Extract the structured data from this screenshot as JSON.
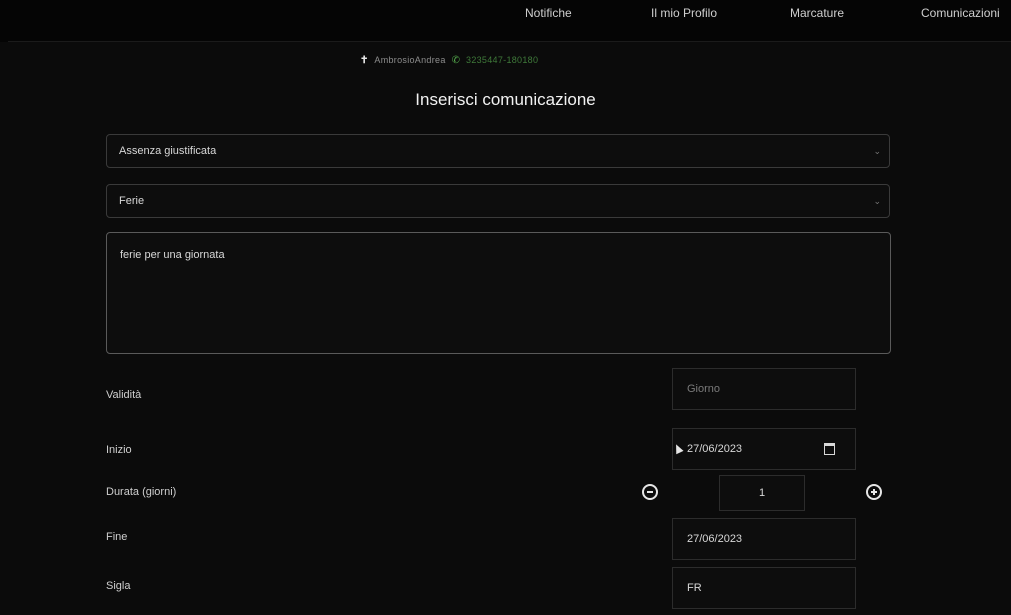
{
  "nav": {
    "items": [
      "Notifiche",
      "Il mio Profilo",
      "Marcature",
      "Comunicazioni"
    ]
  },
  "user": {
    "name": "AmbrosioAndrea",
    "phone": "3235447-180180"
  },
  "page": {
    "title": "Inserisci comunicazione"
  },
  "form": {
    "tipo": {
      "value": "Assenza giustificata"
    },
    "causale": {
      "value": "Ferie"
    },
    "note": {
      "value": "ferie per una giornata"
    },
    "validita": {
      "label": "Validità",
      "placeholder": "Giorno"
    },
    "inizio": {
      "label": "Inizio",
      "value": "27/06/2023"
    },
    "durata": {
      "label": "Durata (giorni)",
      "value": "1"
    },
    "fine": {
      "label": "Fine",
      "value": "27/06/2023"
    },
    "sigla": {
      "label": "Sigla",
      "value": "FR"
    }
  },
  "icons": {
    "person": "person-icon",
    "phone": "phone-icon",
    "chevron": "chevron-down-icon",
    "calendar": "calendar-icon",
    "minus": "minus-circle-icon",
    "plus": "plus-circle-icon"
  },
  "colors": {
    "background": "#0b0b0b",
    "accent_green": "#53a84b",
    "text": "#e6e6e6"
  }
}
